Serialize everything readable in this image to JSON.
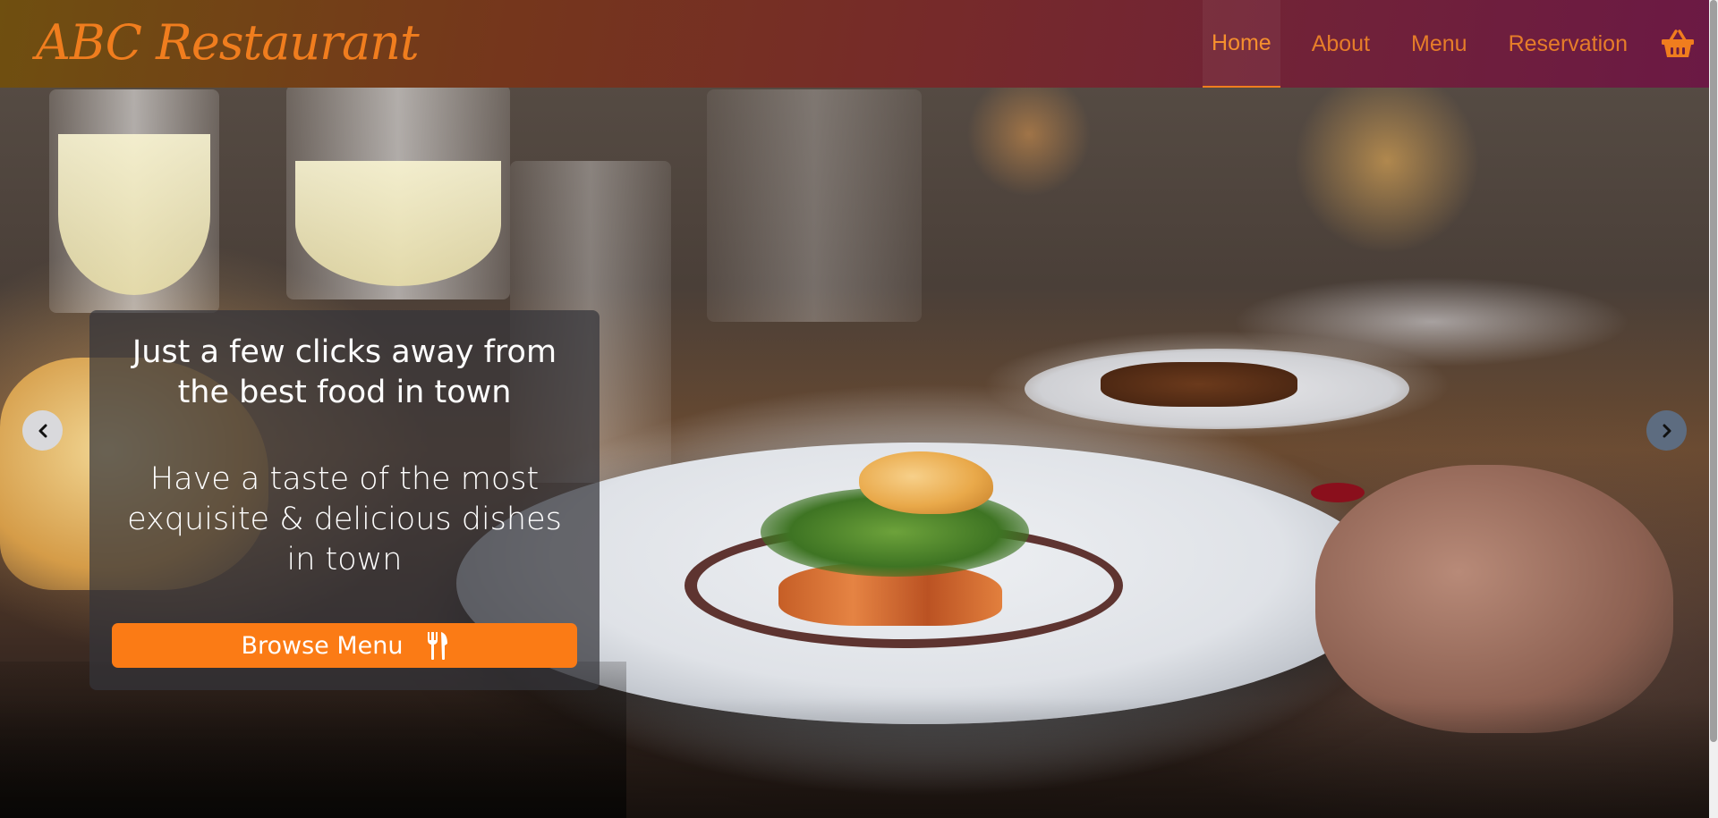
{
  "brand": {
    "name": "ABC Restaurant"
  },
  "nav": {
    "items": [
      {
        "label": "Home",
        "active": true
      },
      {
        "label": "About",
        "active": false
      },
      {
        "label": "Menu",
        "active": false
      },
      {
        "label": "Reservation",
        "active": false
      }
    ],
    "cart_icon": "shopping-basket-icon"
  },
  "hero": {
    "heading": "Just a few clicks away from the best food in town",
    "subheading": "Have a taste of the most exquisite & delicious dishes in town",
    "cta_label": "Browse Menu",
    "cta_icon": "utensils-icon",
    "prev_icon": "chevron-left-icon",
    "next_icon": "chevron-right-icon"
  },
  "colors": {
    "accent": "#fb7b15",
    "brand": "#f07d1e",
    "nav_link": "#e67d29"
  }
}
